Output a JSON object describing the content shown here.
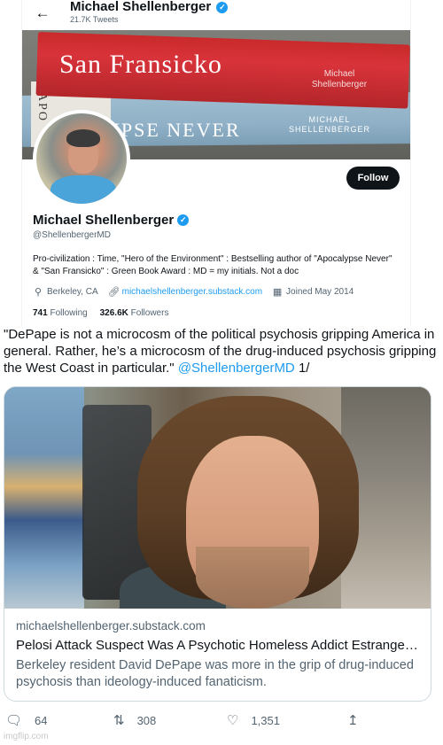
{
  "header": {
    "back_icon": "arrow-left-icon",
    "name": "Michael Shellenberger",
    "tweet_count": "21.7K Tweets"
  },
  "banner": {
    "book_red_title": "San Fransicko",
    "book_red_author": "Michael Shellenberger",
    "book_blue_title": "YPSE NEVER",
    "book_blue_author": "MICHAEL SHELLENBERGER",
    "book_white_text": "APO"
  },
  "profile": {
    "follow_label": "Follow",
    "display_name": "Michael Shellenberger",
    "verified_glyph": "✓",
    "handle": "@ShellenbergerMD",
    "bio": "Pro-civilization : Time, \"Hero of the Environment\" : Bestselling author of \"Apocalypse Never\" & \"San Fransicko\" : Green Book Award : MD = my initials. Not a doc",
    "location": "Berkeley, CA",
    "website": "michaelshellenberger.substack.com",
    "joined": "Joined May 2014",
    "following_count": "741",
    "following_label": "Following",
    "followers_count": "326.6K",
    "followers_label": "Followers"
  },
  "tweet": {
    "text": "\"DePape is not a microcosm of the political psychosis gripping America in general. Rather, he’s a microcosm of the drug-induced psychosis gripping the West Coast in particular.\"",
    "mention": "@ShellenbergerMD",
    "suffix": "1/"
  },
  "link_card": {
    "domain": "michaelshellenberger.substack.com",
    "title": "Pelosi Attack Suspect Was A Psychotic Homeless Addict Estranged From Family",
    "description": "Berkeley resident David DePape was more in the grip of drug-induced psychosis than ideology-induced fanaticism."
  },
  "actions": {
    "replies": "64",
    "retweets": "308",
    "likes": "1,351"
  },
  "watermark": "imgflip.com",
  "colors": {
    "accent": "#1d9bf0",
    "text": "#0f1419",
    "secondary": "#536471",
    "border": "#cfd9de"
  }
}
